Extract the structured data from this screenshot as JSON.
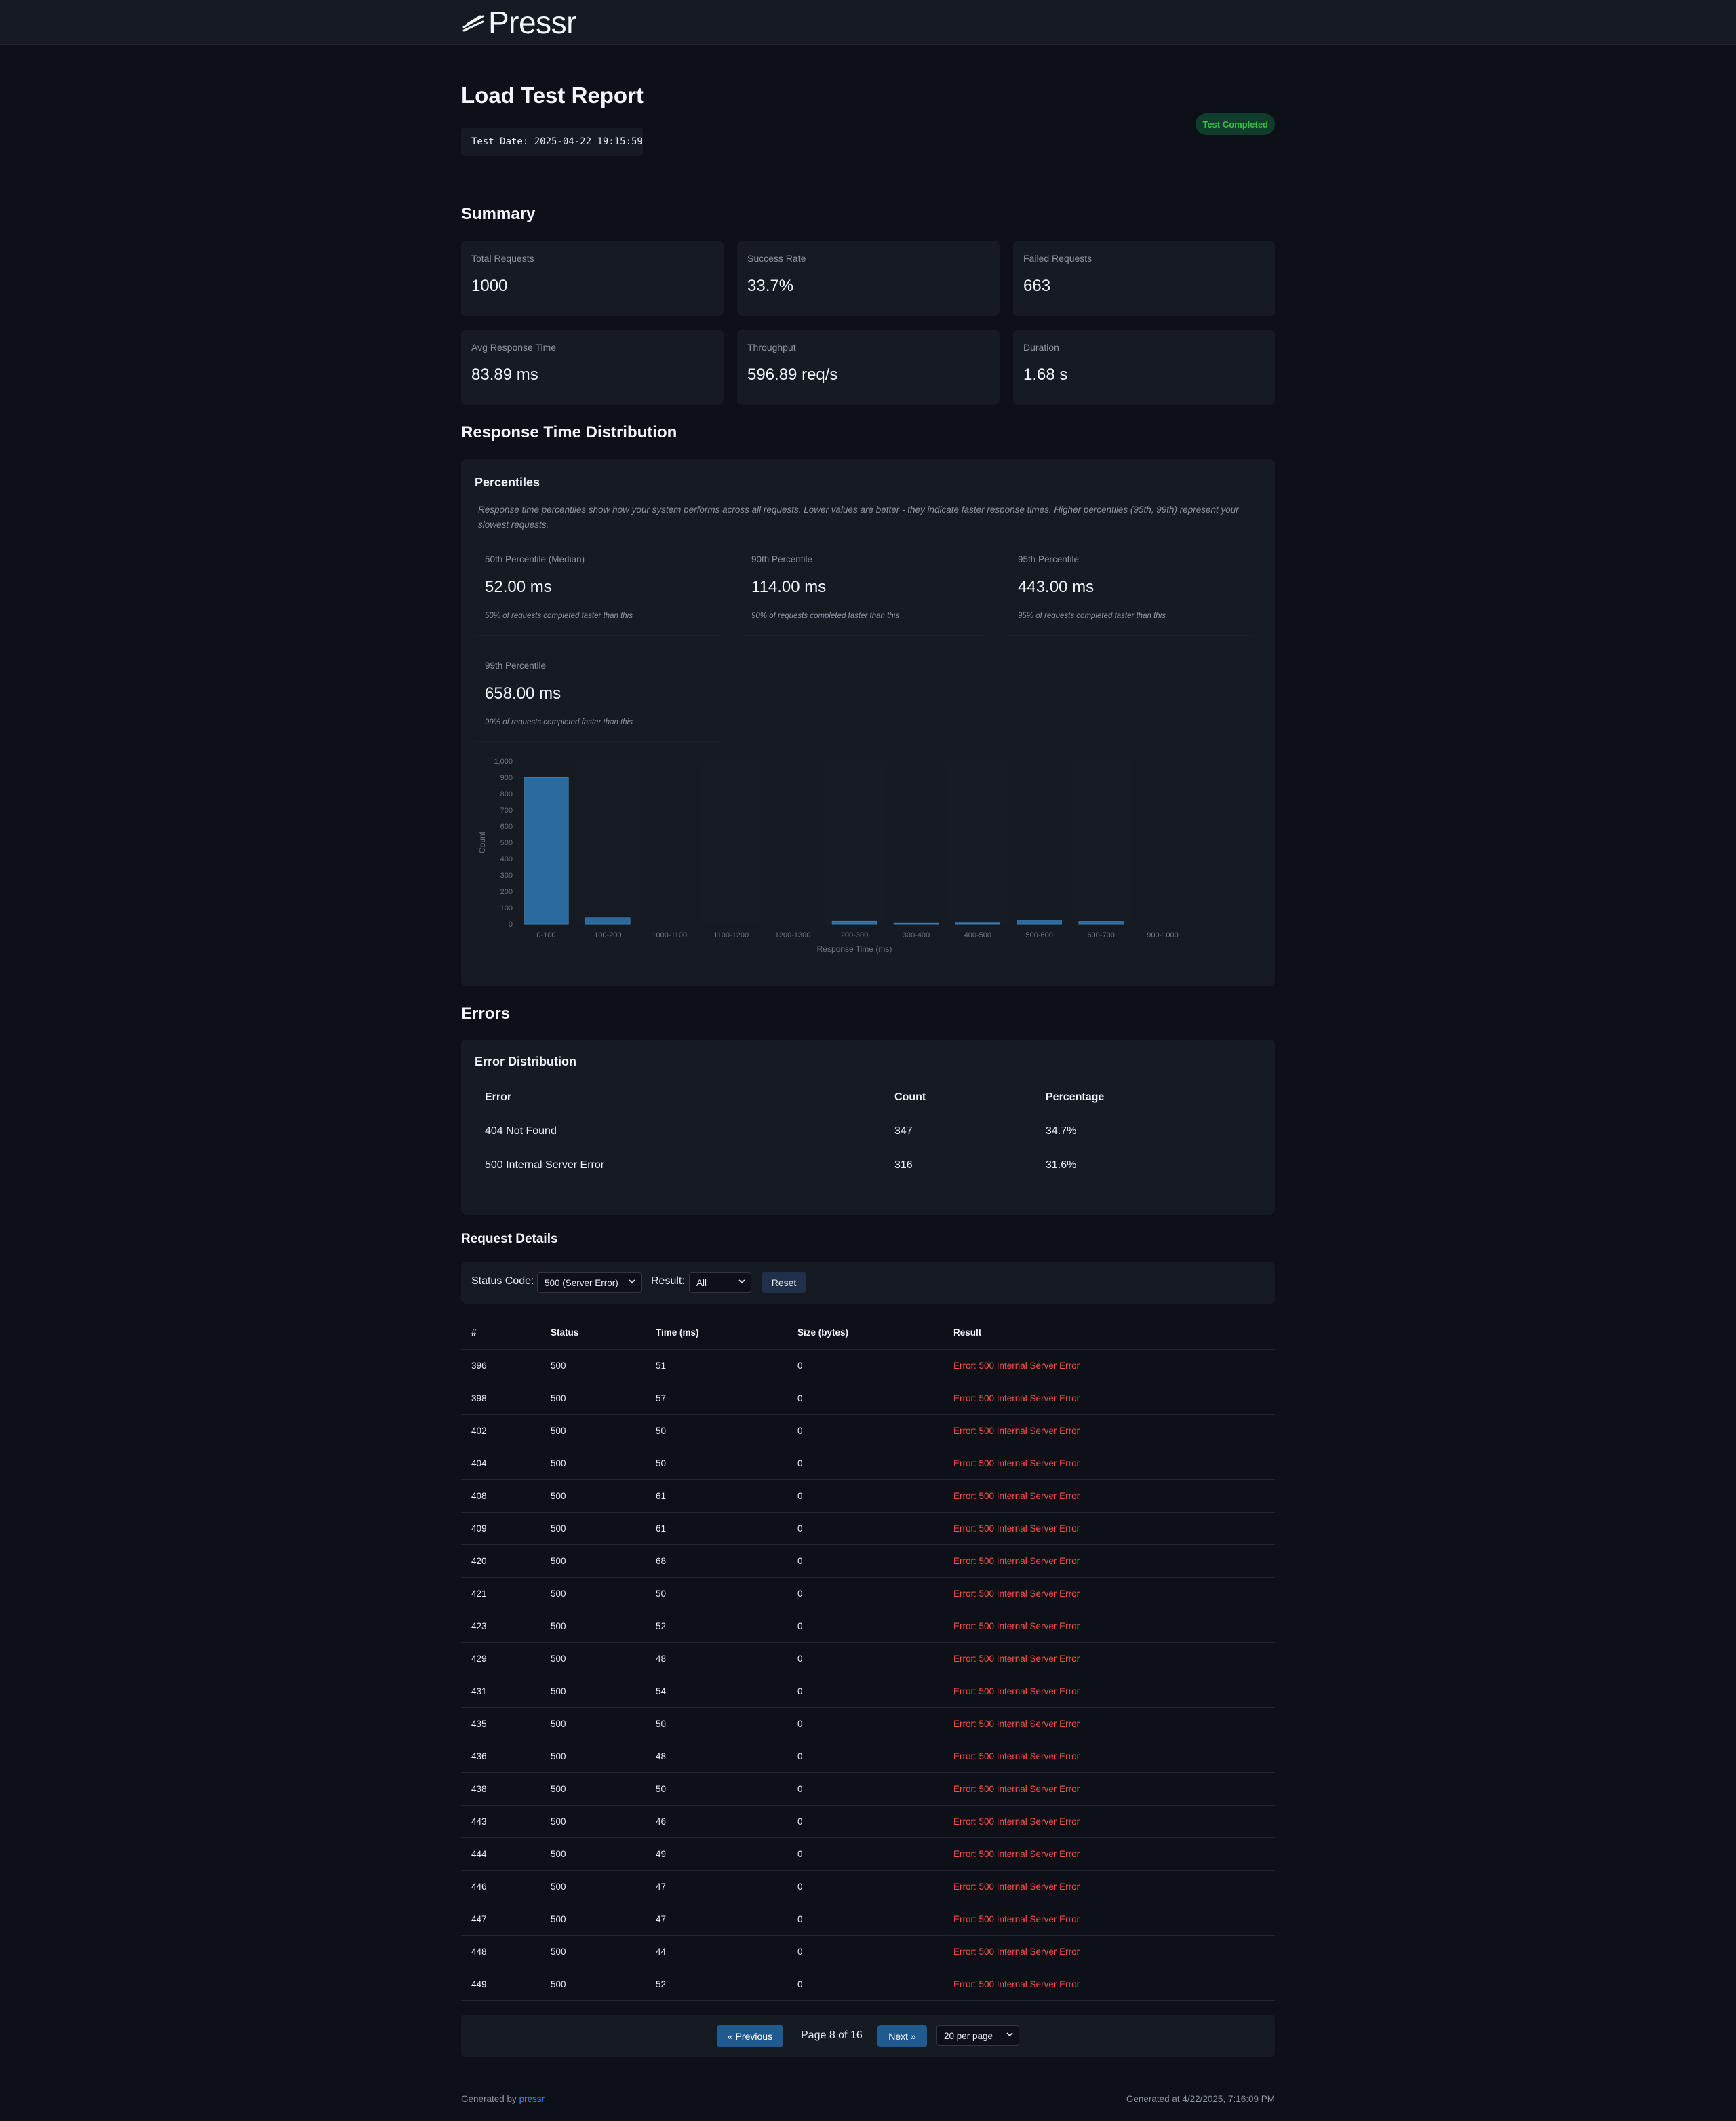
{
  "brand": {
    "name": "Pressr"
  },
  "header": {
    "title": "Load Test Report",
    "test_date": "Test Date: 2025-04-22 19:15:59",
    "status_badge": "Test Completed"
  },
  "summary": {
    "heading": "Summary",
    "stats": [
      {
        "label": "Total Requests",
        "value": "1000"
      },
      {
        "label": "Success Rate",
        "value": "33.7%"
      },
      {
        "label": "Failed Requests",
        "value": "663"
      },
      {
        "label": "Avg Response Time",
        "value": "83.89 ms"
      },
      {
        "label": "Throughput",
        "value": "596.89 req/s"
      },
      {
        "label": "Duration",
        "value": "1.68 s"
      }
    ]
  },
  "distribution": {
    "heading": "Response Time Distribution",
    "panel_title": "Percentiles",
    "description": "Response time percentiles show how your system performs across all requests. Lower values are better - they indicate faster response times. Higher percentiles (95th, 99th) represent your slowest requests.",
    "percentiles": [
      {
        "label": "50th Percentile (Median)",
        "value": "52.00 ms",
        "note": "50% of requests completed faster than this"
      },
      {
        "label": "90th Percentile",
        "value": "114.00 ms",
        "note": "90% of requests completed faster than this"
      },
      {
        "label": "95th Percentile",
        "value": "443.00 ms",
        "note": "95% of requests completed faster than this"
      },
      {
        "label": "99th Percentile",
        "value": "658.00 ms",
        "note": "99% of requests completed faster than this"
      }
    ]
  },
  "chart_data": {
    "type": "bar",
    "categories": [
      "0-100",
      "100-200",
      "1000-1100",
      "1100-1200",
      "1200-1300",
      "200-300",
      "300-400",
      "400-500",
      "500-600",
      "600-700",
      "900-1000"
    ],
    "values": [
      898,
      38,
      0,
      0,
      0,
      15,
      3,
      5,
      18,
      14,
      0
    ],
    "xlabel": "Response Time (ms)",
    "ylabel": "Count",
    "ylim": [
      0,
      1000
    ],
    "yticks": [
      "0",
      "100",
      "200",
      "300",
      "400",
      "500",
      "600",
      "700",
      "800",
      "900",
      "1,000"
    ],
    "grid": false,
    "bar_color": "#2b6a9e"
  },
  "errors": {
    "heading": "Errors",
    "panel_title": "Error Distribution",
    "columns": [
      "Error",
      "Count",
      "Percentage"
    ],
    "rows": [
      [
        "404 Not Found",
        "347",
        "34.7%"
      ],
      [
        "500 Internal Server Error",
        "316",
        "31.6%"
      ]
    ]
  },
  "requests": {
    "heading": "Request Details",
    "filters": {
      "status_label": "Status Code:",
      "status_value": "500 (Server Error)",
      "result_label": "Result:",
      "result_value": "All",
      "reset_label": "Reset"
    },
    "columns": [
      "#",
      "Status",
      "Time (ms)",
      "Size (bytes)",
      "Result"
    ],
    "rows": [
      [
        "396",
        "500",
        "51",
        "0",
        "Error: 500 Internal Server Error"
      ],
      [
        "398",
        "500",
        "57",
        "0",
        "Error: 500 Internal Server Error"
      ],
      [
        "402",
        "500",
        "50",
        "0",
        "Error: 500 Internal Server Error"
      ],
      [
        "404",
        "500",
        "50",
        "0",
        "Error: 500 Internal Server Error"
      ],
      [
        "408",
        "500",
        "61",
        "0",
        "Error: 500 Internal Server Error"
      ],
      [
        "409",
        "500",
        "61",
        "0",
        "Error: 500 Internal Server Error"
      ],
      [
        "420",
        "500",
        "68",
        "0",
        "Error: 500 Internal Server Error"
      ],
      [
        "421",
        "500",
        "50",
        "0",
        "Error: 500 Internal Server Error"
      ],
      [
        "423",
        "500",
        "52",
        "0",
        "Error: 500 Internal Server Error"
      ],
      [
        "429",
        "500",
        "48",
        "0",
        "Error: 500 Internal Server Error"
      ],
      [
        "431",
        "500",
        "54",
        "0",
        "Error: 500 Internal Server Error"
      ],
      [
        "435",
        "500",
        "50",
        "0",
        "Error: 500 Internal Server Error"
      ],
      [
        "436",
        "500",
        "48",
        "0",
        "Error: 500 Internal Server Error"
      ],
      [
        "438",
        "500",
        "50",
        "0",
        "Error: 500 Internal Server Error"
      ],
      [
        "443",
        "500",
        "46",
        "0",
        "Error: 500 Internal Server Error"
      ],
      [
        "444",
        "500",
        "49",
        "0",
        "Error: 500 Internal Server Error"
      ],
      [
        "446",
        "500",
        "47",
        "0",
        "Error: 500 Internal Server Error"
      ],
      [
        "447",
        "500",
        "47",
        "0",
        "Error: 500 Internal Server Error"
      ],
      [
        "448",
        "500",
        "44",
        "0",
        "Error: 500 Internal Server Error"
      ],
      [
        "449",
        "500",
        "52",
        "0",
        "Error: 500 Internal Server Error"
      ]
    ]
  },
  "pagination": {
    "prev_label": "« Previous",
    "page_info": "Page 8 of 16",
    "next_label": "Next »",
    "per_page": "20 per page"
  },
  "footer": {
    "generated_by_prefix": "Generated by ",
    "generated_by_link": "pressr",
    "generated_at": "Generated at 4/22/2025, 7:16:09 PM"
  },
  "colors": {
    "background": "#0d1117",
    "card": "#161b22",
    "success": "#3fb950",
    "error": "#f85149",
    "accent": "#1f5b8f"
  }
}
